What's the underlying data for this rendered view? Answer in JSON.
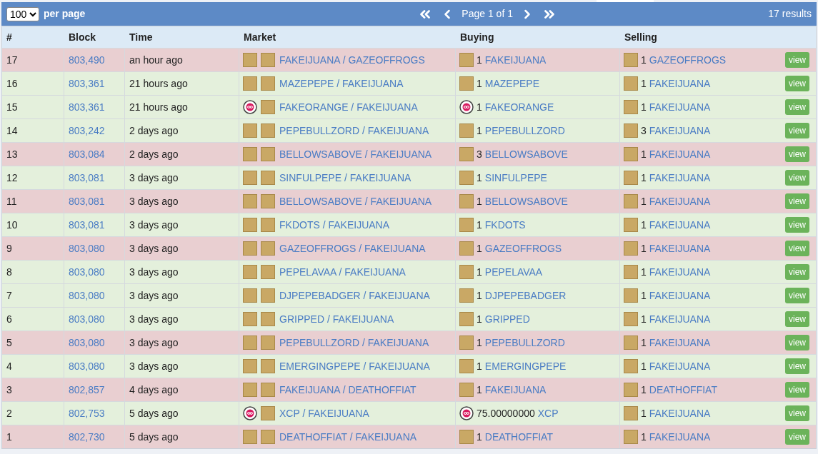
{
  "toolbar": {
    "per_page_value": "100",
    "per_page_label": "per page",
    "page_label": "Page 1 of 1",
    "results": "17 results"
  },
  "table": {
    "columns": [
      "#",
      "Block",
      "Time",
      "Market",
      "Buying",
      "Selling"
    ],
    "rows": [
      {
        "kind": "sell",
        "num": "17",
        "block": "803,490",
        "time": "an hour ago",
        "market": "FAKEIJUANA / GAZEOFFROGS",
        "buying": {
          "kind": "token",
          "qty": "1",
          "asset": "FAKEIJUANA"
        },
        "selling": {
          "kind": "token",
          "qty": "1",
          "asset": "GAZEOFFROGS"
        },
        "action": "view"
      },
      {
        "kind": "buy",
        "num": "16",
        "block": "803,361",
        "time": "21 hours ago",
        "market": "MAZEPEPE / FAKEIJUANA",
        "buying": {
          "kind": "token",
          "qty": "1",
          "asset": "MAZEPEPE"
        },
        "selling": {
          "kind": "token",
          "qty": "1",
          "asset": "FAKEIJUANA"
        },
        "action": "view"
      },
      {
        "kind": "buy",
        "num": "15",
        "block": "803,361",
        "time": "21 hours ago",
        "market": "FAKEORANGE / FAKEIJUANA",
        "buying": {
          "kind": "coin",
          "qty": "1",
          "asset": "FAKEORANGE"
        },
        "selling": {
          "kind": "token",
          "qty": "1",
          "asset": "FAKEIJUANA"
        },
        "action": "view"
      },
      {
        "kind": "buy",
        "num": "14",
        "block": "803,242",
        "time": "2 days ago",
        "market": "PEPEBULLZORD / FAKEIJUANA",
        "buying": {
          "kind": "token",
          "qty": "1",
          "asset": "PEPEBULLZORD"
        },
        "selling": {
          "kind": "token",
          "qty": "3",
          "asset": "FAKEIJUANA"
        },
        "action": "view"
      },
      {
        "kind": "sell",
        "num": "13",
        "block": "803,084",
        "time": "2 days ago",
        "market": "BELLOWSABOVE / FAKEIJUANA",
        "buying": {
          "kind": "token",
          "qty": "3",
          "asset": "BELLOWSABOVE"
        },
        "selling": {
          "kind": "token",
          "qty": "1",
          "asset": "FAKEIJUANA"
        },
        "action": "view"
      },
      {
        "kind": "buy",
        "num": "12",
        "block": "803,081",
        "time": "3 days ago",
        "market": "SINFULPEPE / FAKEIJUANA",
        "buying": {
          "kind": "token",
          "qty": "1",
          "asset": "SINFULPEPE"
        },
        "selling": {
          "kind": "token",
          "qty": "1",
          "asset": "FAKEIJUANA"
        },
        "action": "view"
      },
      {
        "kind": "sell",
        "num": "11",
        "block": "803,081",
        "time": "3 days ago",
        "market": "BELLOWSABOVE / FAKEIJUANA",
        "buying": {
          "kind": "token",
          "qty": "1",
          "asset": "BELLOWSABOVE"
        },
        "selling": {
          "kind": "token",
          "qty": "1",
          "asset": "FAKEIJUANA"
        },
        "action": "view"
      },
      {
        "kind": "buy",
        "num": "10",
        "block": "803,081",
        "time": "3 days ago",
        "market": "FKDOTS / FAKEIJUANA",
        "buying": {
          "kind": "token",
          "qty": "1",
          "asset": "FKDOTS"
        },
        "selling": {
          "kind": "token",
          "qty": "1",
          "asset": "FAKEIJUANA"
        },
        "action": "view"
      },
      {
        "kind": "sell",
        "num": "9",
        "block": "803,080",
        "time": "3 days ago",
        "market": "GAZEOFFROGS / FAKEIJUANA",
        "buying": {
          "kind": "token",
          "qty": "1",
          "asset": "GAZEOFFROGS"
        },
        "selling": {
          "kind": "token",
          "qty": "1",
          "asset": "FAKEIJUANA"
        },
        "action": "view"
      },
      {
        "kind": "buy",
        "num": "8",
        "block": "803,080",
        "time": "3 days ago",
        "market": "PEPELAVAA / FAKEIJUANA",
        "buying": {
          "kind": "token",
          "qty": "1",
          "asset": "PEPELAVAA"
        },
        "selling": {
          "kind": "token",
          "qty": "1",
          "asset": "FAKEIJUANA"
        },
        "action": "view"
      },
      {
        "kind": "buy",
        "num": "7",
        "block": "803,080",
        "time": "3 days ago",
        "market": "DJPEPEBADGER / FAKEIJUANA",
        "buying": {
          "kind": "token",
          "qty": "1",
          "asset": "DJPEPEBADGER"
        },
        "selling": {
          "kind": "token",
          "qty": "1",
          "asset": "FAKEIJUANA"
        },
        "action": "view"
      },
      {
        "kind": "buy",
        "num": "6",
        "block": "803,080",
        "time": "3 days ago",
        "market": "GRIPPED / FAKEIJUANA",
        "buying": {
          "kind": "token",
          "qty": "1",
          "asset": "GRIPPED"
        },
        "selling": {
          "kind": "token",
          "qty": "1",
          "asset": "FAKEIJUANA"
        },
        "action": "view"
      },
      {
        "kind": "sell",
        "num": "5",
        "block": "803,080",
        "time": "3 days ago",
        "market": "PEPEBULLZORD / FAKEIJUANA",
        "buying": {
          "kind": "token",
          "qty": "1",
          "asset": "PEPEBULLZORD"
        },
        "selling": {
          "kind": "token",
          "qty": "1",
          "asset": "FAKEIJUANA"
        },
        "action": "view"
      },
      {
        "kind": "buy",
        "num": "4",
        "block": "803,080",
        "time": "3 days ago",
        "market": "EMERGINGPEPE / FAKEIJUANA",
        "buying": {
          "kind": "token",
          "qty": "1",
          "asset": "EMERGINGPEPE"
        },
        "selling": {
          "kind": "token",
          "qty": "1",
          "asset": "FAKEIJUANA"
        },
        "action": "view"
      },
      {
        "kind": "sell",
        "num": "3",
        "block": "802,857",
        "time": "4 days ago",
        "market": "FAKEIJUANA / DEATHOFFIAT",
        "buying": {
          "kind": "token",
          "qty": "1",
          "asset": "FAKEIJUANA"
        },
        "selling": {
          "kind": "token",
          "qty": "1",
          "asset": "DEATHOFFIAT"
        },
        "action": "view"
      },
      {
        "kind": "buy",
        "num": "2",
        "block": "802,753",
        "time": "5 days ago",
        "market": "XCP / FAKEIJUANA",
        "buying": {
          "kind": "coin",
          "qty": "75.00000000",
          "asset": "XCP"
        },
        "selling": {
          "kind": "token",
          "qty": "1",
          "asset": "FAKEIJUANA"
        },
        "action": "view"
      },
      {
        "kind": "sell",
        "num": "1",
        "block": "802,730",
        "time": "5 days ago",
        "market": "DEATHOFFIAT / FAKEIJUANA",
        "buying": {
          "kind": "token",
          "qty": "1",
          "asset": "DEATHOFFIAT"
        },
        "selling": {
          "kind": "token",
          "qty": "1",
          "asset": "FAKEIJUANA"
        },
        "action": "view"
      }
    ]
  }
}
